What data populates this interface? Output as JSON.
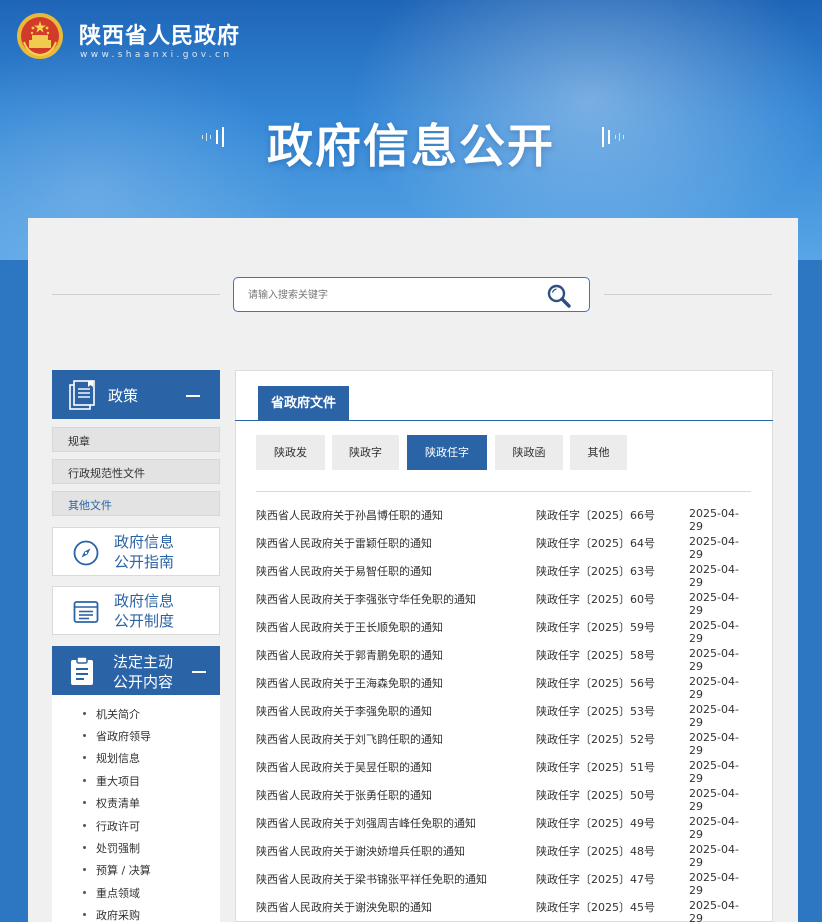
{
  "header": {
    "site_title": "陕西省人民政府",
    "site_url": "www.shaanxi.gov.cn",
    "page_title": "政府信息公开"
  },
  "search": {
    "placeholder": "请输入搜索关键字"
  },
  "sidebar": {
    "policy": {
      "label": "政策",
      "items": [
        "规章",
        "行政规范性文件",
        "其他文件"
      ]
    },
    "guide_label": [
      "政府信息",
      "公开指南"
    ],
    "system_label": [
      "政府信息",
      "公开制度"
    ],
    "statutory": {
      "label": [
        "法定主动",
        "公开内容"
      ],
      "items": [
        "机关简介",
        "省政府领导",
        "规划信息",
        "重大项目",
        "权责清单",
        "行政许可",
        "处罚强制",
        "预算 / 决算",
        "重点领域",
        "政府采购"
      ]
    }
  },
  "main": {
    "section_tab": "省政府文件",
    "subtabs": [
      "陕政发",
      "陕政字",
      "陕政任字",
      "陕政函",
      "其他"
    ],
    "active_subtab": "陕政任字",
    "documents": [
      {
        "title": "陕西省人民政府关于孙昌博任职的通知",
        "number": "陕政任字〔2025〕66号",
        "date": "2025-04-29"
      },
      {
        "title": "陕西省人民政府关于雷颖任职的通知",
        "number": "陕政任字〔2025〕64号",
        "date": "2025-04-29"
      },
      {
        "title": "陕西省人民政府关于易智任职的通知",
        "number": "陕政任字〔2025〕63号",
        "date": "2025-04-29"
      },
      {
        "title": "陕西省人民政府关于李强张守华任免职的通知",
        "number": "陕政任字〔2025〕60号",
        "date": "2025-04-29"
      },
      {
        "title": "陕西省人民政府关于王长顺免职的通知",
        "number": "陕政任字〔2025〕59号",
        "date": "2025-04-29"
      },
      {
        "title": "陕西省人民政府关于郭青鹏免职的通知",
        "number": "陕政任字〔2025〕58号",
        "date": "2025-04-29"
      },
      {
        "title": "陕西省人民政府关于王海森免职的通知",
        "number": "陕政任字〔2025〕56号",
        "date": "2025-04-29"
      },
      {
        "title": "陕西省人民政府关于李强免职的通知",
        "number": "陕政任字〔2025〕53号",
        "date": "2025-04-29"
      },
      {
        "title": "陕西省人民政府关于刘飞鹍任职的通知",
        "number": "陕政任字〔2025〕52号",
        "date": "2025-04-29"
      },
      {
        "title": "陕西省人民政府关于吴昱任职的通知",
        "number": "陕政任字〔2025〕51号",
        "date": "2025-04-29"
      },
      {
        "title": "陕西省人民政府关于张勇任职的通知",
        "number": "陕政任字〔2025〕50号",
        "date": "2025-04-29"
      },
      {
        "title": "陕西省人民政府关于刘强周吉峰任免职的通知",
        "number": "陕政任字〔2025〕49号",
        "date": "2025-04-29"
      },
      {
        "title": "陕西省人民政府关于谢泱娇增兵任职的通知",
        "number": "陕政任字〔2025〕48号",
        "date": "2025-04-29"
      },
      {
        "title": "陕西省人民政府关于梁书锦张平祥任免职的通知",
        "number": "陕政任字〔2025〕47号",
        "date": "2025-04-29"
      },
      {
        "title": "陕西省人民政府关于谢泱免职的通知",
        "number": "陕政任字〔2025〕45号",
        "date": "2025-04-29"
      }
    ]
  },
  "colors": {
    "primary": "#2b64a6",
    "header_top": "#1f65b7",
    "panel_bg": "#f0f0f0"
  }
}
